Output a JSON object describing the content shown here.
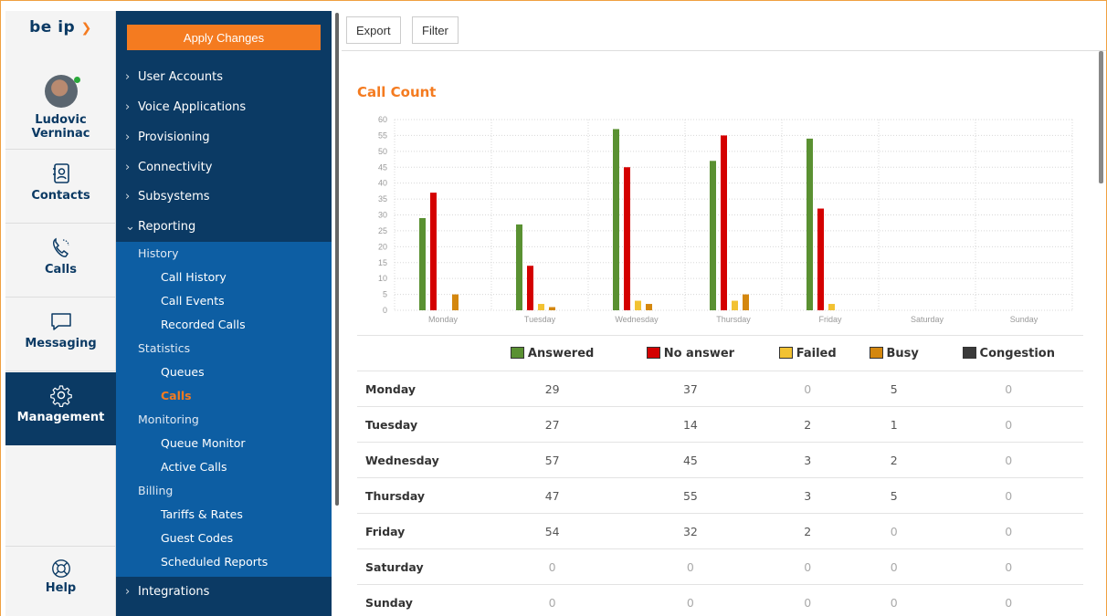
{
  "app": {
    "logo_text": "be ip",
    "logo_mark": "❯"
  },
  "user": {
    "name": "Ludovic Verninac"
  },
  "rail": [
    {
      "label": "Contacts",
      "icon": "contacts-icon"
    },
    {
      "label": "Calls",
      "icon": "phone-icon"
    },
    {
      "label": "Messaging",
      "icon": "message-icon"
    },
    {
      "label": "Management",
      "icon": "gear-icon"
    }
  ],
  "help": {
    "label": "Help",
    "icon": "lifebuoy-icon"
  },
  "nav": {
    "apply_label": "Apply Changes",
    "items": [
      {
        "label": "User Accounts"
      },
      {
        "label": "Voice Applications"
      },
      {
        "label": "Provisioning"
      },
      {
        "label": "Connectivity"
      },
      {
        "label": "Subsystems"
      },
      {
        "label": "Reporting"
      },
      {
        "label": "Integrations"
      }
    ],
    "reporting_sub": [
      {
        "label": "History",
        "level": 1
      },
      {
        "label": "Call History",
        "level": 2
      },
      {
        "label": "Call Events",
        "level": 2
      },
      {
        "label": "Recorded Calls",
        "level": 2
      },
      {
        "label": "Statistics",
        "level": 1
      },
      {
        "label": "Queues",
        "level": 2
      },
      {
        "label": "Calls",
        "level": 2
      },
      {
        "label": "Monitoring",
        "level": 1
      },
      {
        "label": "Queue Monitor",
        "level": 2
      },
      {
        "label": "Active Calls",
        "level": 2
      },
      {
        "label": "Billing",
        "level": 1
      },
      {
        "label": "Tariffs & Rates",
        "level": 2
      },
      {
        "label": "Guest Codes",
        "level": 2
      },
      {
        "label": "Scheduled Reports",
        "level": 2
      }
    ],
    "active_sub": "Calls"
  },
  "toolbar": {
    "export_label": "Export",
    "filter_label": "Filter"
  },
  "section_title": "Call Count",
  "colors": {
    "Answered": "#5a9132",
    "No answer": "#d40000",
    "Failed": "#f2c232",
    "Busy": "#d4870e",
    "Congestion": "#3a3a3a"
  },
  "chart_data": {
    "type": "bar",
    "title": "Call Count",
    "categories": [
      "Monday",
      "Tuesday",
      "Wednesday",
      "Thursday",
      "Friday",
      "Saturday",
      "Sunday"
    ],
    "ylim": [
      0,
      60
    ],
    "yticks": [
      0,
      5,
      10,
      15,
      20,
      25,
      30,
      35,
      40,
      45,
      50,
      55,
      60
    ],
    "grid": true,
    "series": [
      {
        "name": "Answered",
        "values": [
          29,
          27,
          57,
          47,
          54,
          0,
          0
        ]
      },
      {
        "name": "No answer",
        "values": [
          37,
          14,
          45,
          55,
          32,
          0,
          0
        ]
      },
      {
        "name": "Failed",
        "values": [
          0,
          2,
          3,
          3,
          2,
          0,
          0
        ]
      },
      {
        "name": "Busy",
        "values": [
          5,
          1,
          2,
          5,
          0,
          0,
          0
        ]
      },
      {
        "name": "Congestion",
        "values": [
          0,
          0,
          0,
          0,
          0,
          0,
          0
        ]
      }
    ]
  }
}
